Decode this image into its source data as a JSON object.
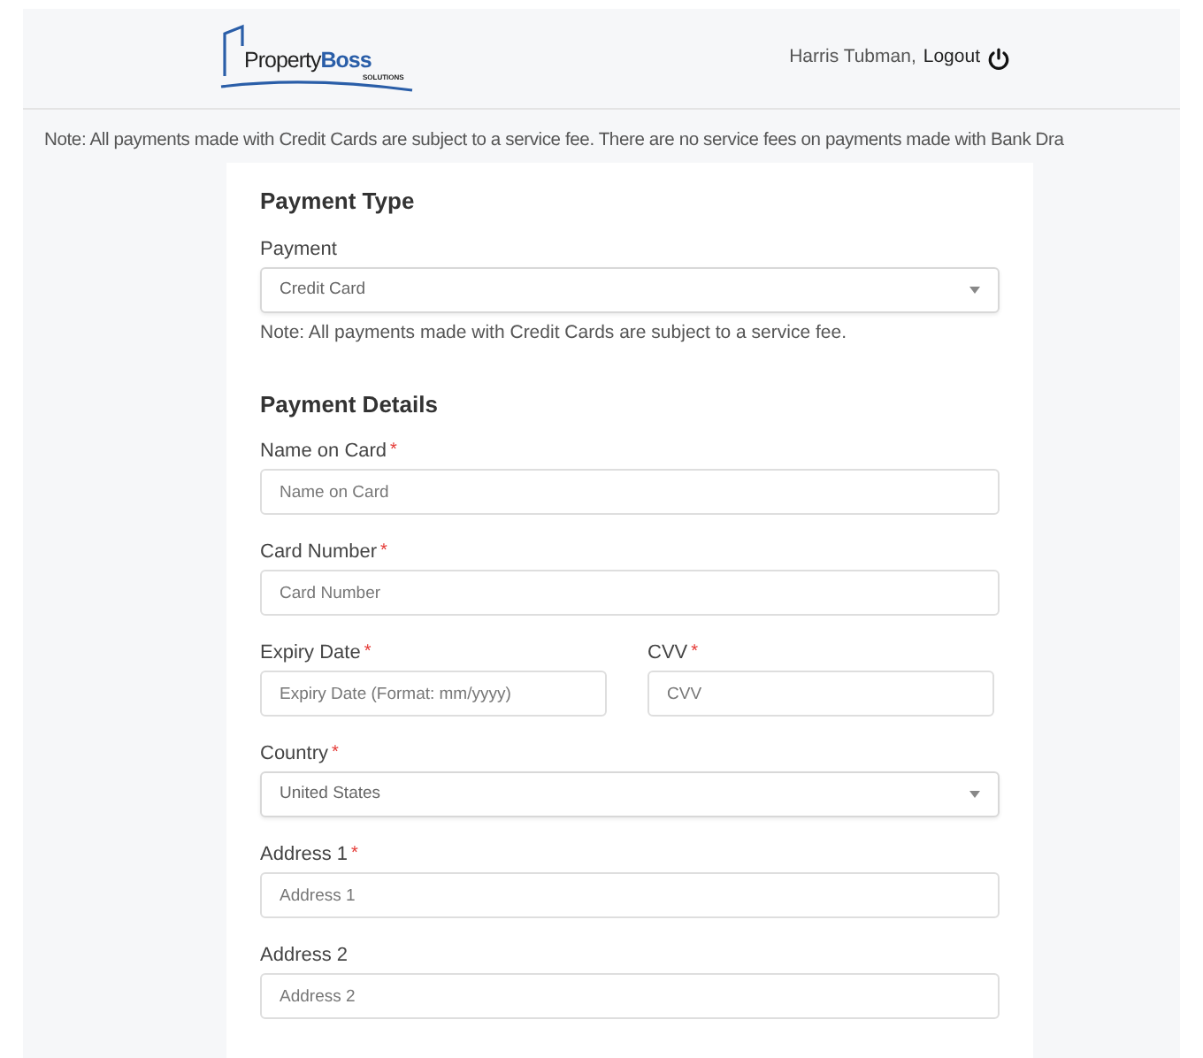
{
  "header": {
    "logo": {
      "name": "Property",
      "name_bold": "Boss",
      "sub": "SOLUTIONS"
    },
    "user": "Harris Tubman,",
    "logout": "Logout"
  },
  "notice": "Note: All payments made with Credit Cards are subject to a service fee. There are no service fees on payments made with Bank Dra",
  "sections": [
    {
      "title": "Payment Type",
      "items": [
        {
          "kind": "select",
          "label": "Payment",
          "value": "Credit Card",
          "note": "Note: All payments made with Credit Cards are subject to a service fee."
        }
      ]
    },
    {
      "title": "Payment Details",
      "items": [
        {
          "kind": "input",
          "label": "Name on Card",
          "marker": "*",
          "placeholder": "Name on Card"
        },
        {
          "kind": "input",
          "label": "Card Number",
          "marker": "*",
          "placeholder": "Card Number"
        },
        {
          "kind": "pair",
          "fields": [
            {
              "kind": "input",
              "label": "Expiry Date",
              "marker": "*",
              "placeholder": "Expiry Date (Format: mm/yyyy)"
            },
            {
              "kind": "input",
              "label": "CVV",
              "marker": "*",
              "placeholder": "CVV"
            }
          ]
        },
        {
          "kind": "select",
          "label": "Country",
          "marker": "*",
          "value": "United States"
        },
        {
          "kind": "input",
          "label": "Address 1",
          "marker": "*",
          "placeholder": "Address 1"
        },
        {
          "kind": "input",
          "label": "Address 2",
          "placeholder": "Address 2"
        }
      ]
    }
  ]
}
